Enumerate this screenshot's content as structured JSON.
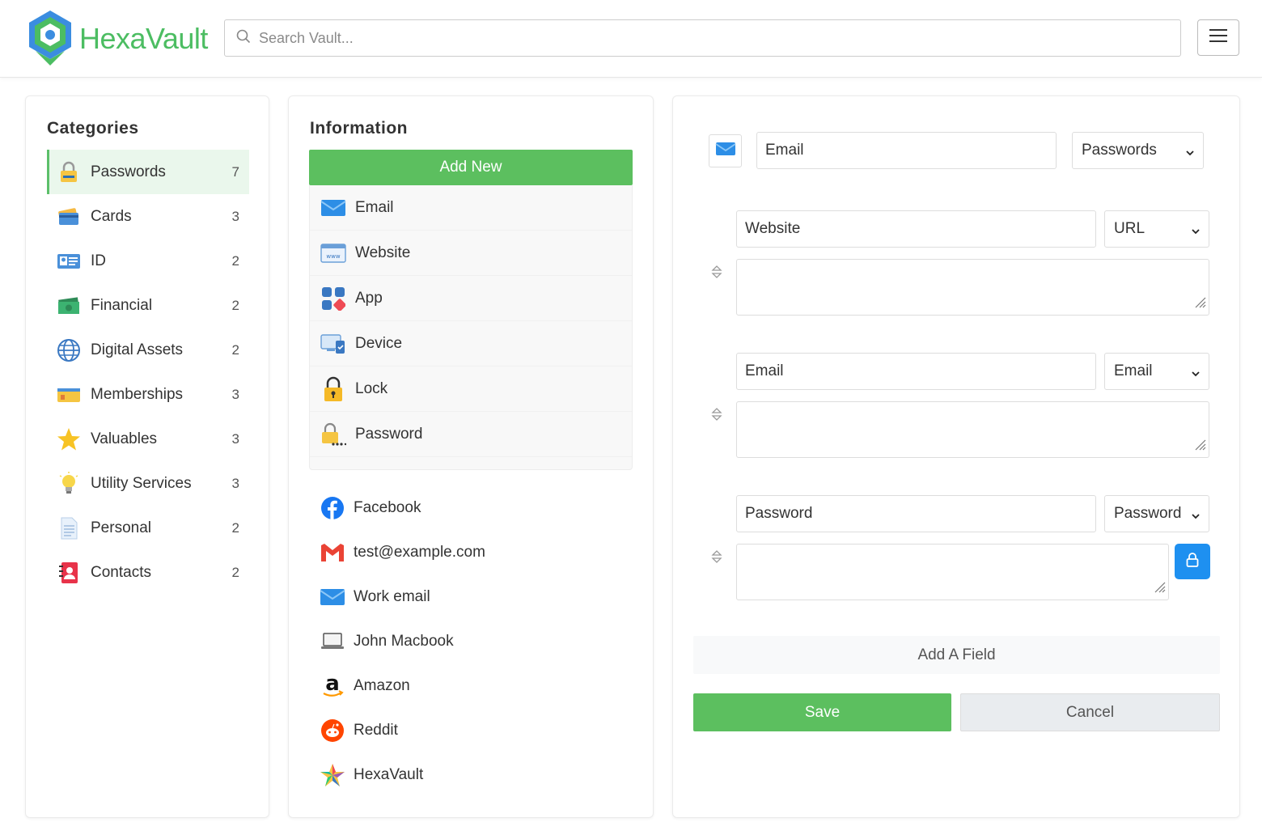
{
  "app": {
    "name": "HexaVault",
    "brand_color": "#4cbd62"
  },
  "search": {
    "placeholder": "Search Vault..."
  },
  "categories": {
    "title": "Categories",
    "items": [
      {
        "label": "Passwords",
        "count": "7",
        "icon": "padlock-icon",
        "active": true
      },
      {
        "label": "Cards",
        "count": "3",
        "icon": "credit-card-icon"
      },
      {
        "label": "ID",
        "count": "2",
        "icon": "id-card-icon"
      },
      {
        "label": "Financial",
        "count": "2",
        "icon": "money-icon"
      },
      {
        "label": "Digital Assets",
        "count": "2",
        "icon": "globe-icon"
      },
      {
        "label": "Memberships",
        "count": "3",
        "icon": "membership-card-icon"
      },
      {
        "label": "Valuables",
        "count": "3",
        "icon": "star-icon"
      },
      {
        "label": "Utility Services",
        "count": "3",
        "icon": "lightbulb-icon"
      },
      {
        "label": "Personal",
        "count": "2",
        "icon": "document-icon"
      },
      {
        "label": "Contacts",
        "count": "2",
        "icon": "address-book-icon"
      }
    ]
  },
  "information": {
    "title": "Information",
    "add_new": "Add New",
    "types": [
      {
        "label": "Email",
        "icon": "envelope-icon"
      },
      {
        "label": "Website",
        "icon": "www-icon"
      },
      {
        "label": "App",
        "icon": "app-grid-icon"
      },
      {
        "label": "Device",
        "icon": "device-icon"
      },
      {
        "label": "Lock",
        "icon": "lock-icon"
      },
      {
        "label": "Password",
        "icon": "password-icon"
      }
    ],
    "entries": [
      {
        "label": "Facebook",
        "icon": "facebook-icon"
      },
      {
        "label": "test@example.com",
        "icon": "gmail-icon"
      },
      {
        "label": "Work email",
        "icon": "envelope-icon"
      },
      {
        "label": "John Macbook",
        "icon": "laptop-icon"
      },
      {
        "label": "Amazon",
        "icon": "amazon-icon"
      },
      {
        "label": "Reddit",
        "icon": "reddit-icon"
      },
      {
        "label": "HexaVault",
        "icon": "hexavault-star-icon"
      }
    ]
  },
  "editor": {
    "name_value": "Email",
    "category_value": "Passwords",
    "fields": [
      {
        "label": "Website",
        "type": "URL",
        "value": ""
      },
      {
        "label": "Email",
        "type": "Email",
        "value": ""
      },
      {
        "label": "Password",
        "type": "Password",
        "value": ""
      }
    ],
    "add_field": "Add A Field",
    "save": "Save",
    "cancel": "Cancel"
  }
}
